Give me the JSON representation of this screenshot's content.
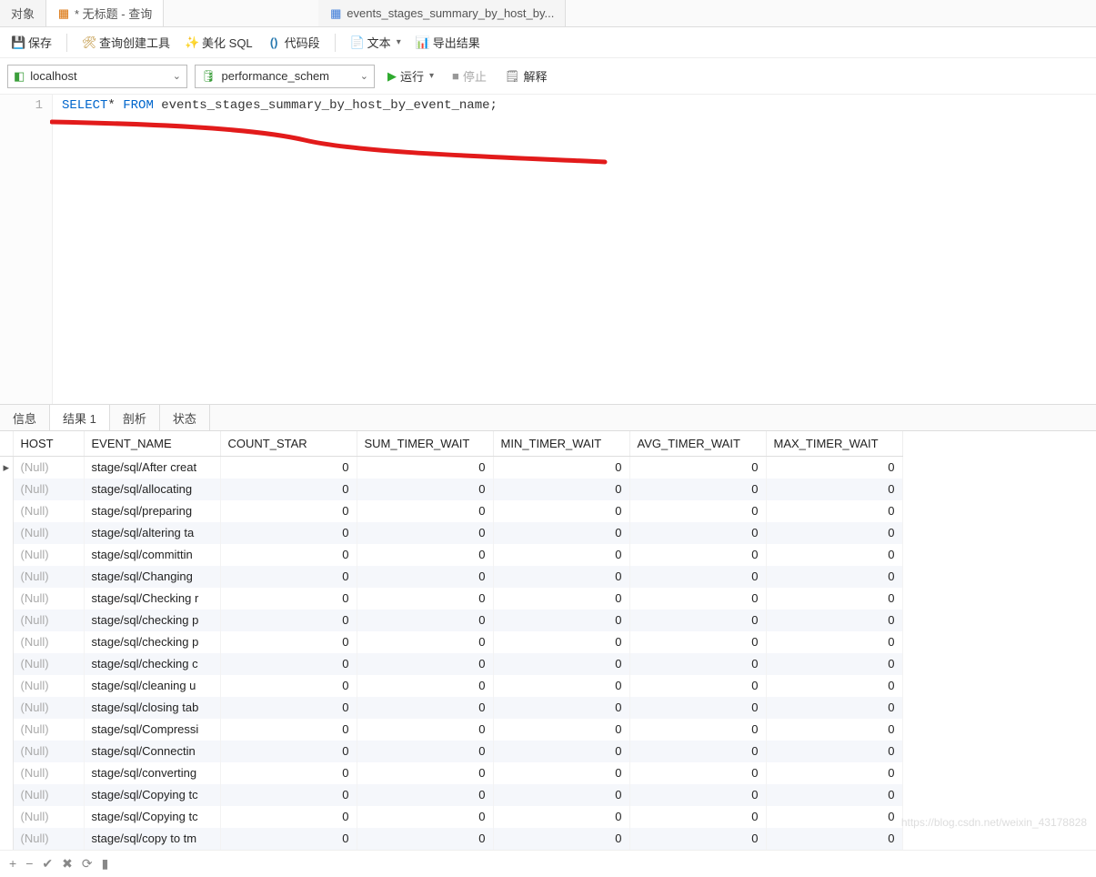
{
  "tabs": {
    "objects": "对象",
    "query": "* 无标题 - 查询",
    "table": "events_stages_summary_by_host_by..."
  },
  "toolbar": {
    "save": "保存",
    "queryBuilder": "查询创建工具",
    "beautify": "美化 SQL",
    "snippet": "代码段",
    "text": "文本",
    "export": "导出结果"
  },
  "connBar": {
    "connection": "localhost",
    "database": "performance_schem",
    "run": "运行",
    "stop": "停止",
    "explain": "解释"
  },
  "editor": {
    "lineNo": "1",
    "kw_select": "SELECT",
    "star": "*",
    "kw_from": "FROM",
    "table_ident": "events_stages_summary_by_host_by_event_name;"
  },
  "resultTabs": {
    "info": "信息",
    "result": "结果 1",
    "profile": "剖析",
    "status": "状态"
  },
  "grid": {
    "nullText": "(Null)",
    "columns": [
      "HOST",
      "EVENT_NAME",
      "COUNT_STAR",
      "SUM_TIMER_WAIT",
      "MIN_TIMER_WAIT",
      "AVG_TIMER_WAIT",
      "MAX_TIMER_WAIT"
    ],
    "rows": [
      {
        "host": null,
        "event": "stage/sql/After creat",
        "v": [
          0,
          0,
          0,
          0,
          0
        ]
      },
      {
        "host": null,
        "event": "stage/sql/allocating ",
        "v": [
          0,
          0,
          0,
          0,
          0
        ]
      },
      {
        "host": null,
        "event": "stage/sql/preparing ",
        "v": [
          0,
          0,
          0,
          0,
          0
        ]
      },
      {
        "host": null,
        "event": "stage/sql/altering ta",
        "v": [
          0,
          0,
          0,
          0,
          0
        ]
      },
      {
        "host": null,
        "event": "stage/sql/committin",
        "v": [
          0,
          0,
          0,
          0,
          0
        ]
      },
      {
        "host": null,
        "event": "stage/sql/Changing ",
        "v": [
          0,
          0,
          0,
          0,
          0
        ]
      },
      {
        "host": null,
        "event": "stage/sql/Checking r",
        "v": [
          0,
          0,
          0,
          0,
          0
        ]
      },
      {
        "host": null,
        "event": "stage/sql/checking p",
        "v": [
          0,
          0,
          0,
          0,
          0
        ]
      },
      {
        "host": null,
        "event": "stage/sql/checking p",
        "v": [
          0,
          0,
          0,
          0,
          0
        ]
      },
      {
        "host": null,
        "event": "stage/sql/checking c",
        "v": [
          0,
          0,
          0,
          0,
          0
        ]
      },
      {
        "host": null,
        "event": "stage/sql/cleaning u",
        "v": [
          0,
          0,
          0,
          0,
          0
        ]
      },
      {
        "host": null,
        "event": "stage/sql/closing tab",
        "v": [
          0,
          0,
          0,
          0,
          0
        ]
      },
      {
        "host": null,
        "event": "stage/sql/Compressi",
        "v": [
          0,
          0,
          0,
          0,
          0
        ]
      },
      {
        "host": null,
        "event": "stage/sql/Connectin",
        "v": [
          0,
          0,
          0,
          0,
          0
        ]
      },
      {
        "host": null,
        "event": "stage/sql/converting",
        "v": [
          0,
          0,
          0,
          0,
          0
        ]
      },
      {
        "host": null,
        "event": "stage/sql/Copying tc",
        "v": [
          0,
          0,
          0,
          0,
          0
        ]
      },
      {
        "host": null,
        "event": "stage/sql/Copying tc",
        "v": [
          0,
          0,
          0,
          0,
          0
        ]
      },
      {
        "host": null,
        "event": "stage/sql/copy to tm",
        "v": [
          0,
          0,
          0,
          0,
          0
        ]
      }
    ]
  },
  "watermark": "https://blog.csdn.net/weixin_43178828"
}
